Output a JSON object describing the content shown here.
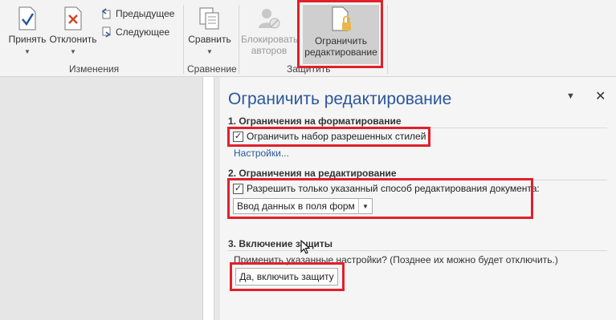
{
  "ribbon": {
    "accept": "Принять",
    "reject": "Отклонить",
    "previous": "Предыдущее",
    "next": "Следующее",
    "group_changes": "Изменения",
    "compare": "Сравнить",
    "group_compare": "Сравнение",
    "block_authors_line1": "Блокировать",
    "block_authors_line2": "авторов",
    "restrict_line1": "Ограничить",
    "restrict_line2": "редактирование",
    "group_protect": "Защитить"
  },
  "pane": {
    "title": "Ограничить редактирование",
    "menu_icon": "▼",
    "close_icon": "✕",
    "section1": {
      "heading": "1. Ограничения на форматирование",
      "checkbox_label": "Ограничить набор разрешенных стилей",
      "checked": true,
      "settings_link": "Настройки..."
    },
    "section2": {
      "heading": "2. Ограничения на редактирование",
      "checkbox_label": "Разрешить только указанный способ редактирования документа:",
      "checked": true,
      "select_value": "Ввод данных в поля форм"
    },
    "section3": {
      "heading": "3. Включение защиты",
      "note": "Применить указанные настройки? (Позднее их можно будет отключить.)",
      "button": "Да, включить защиту"
    }
  },
  "colors": {
    "accent": "#2b579a",
    "highlight": "#e0202a"
  }
}
